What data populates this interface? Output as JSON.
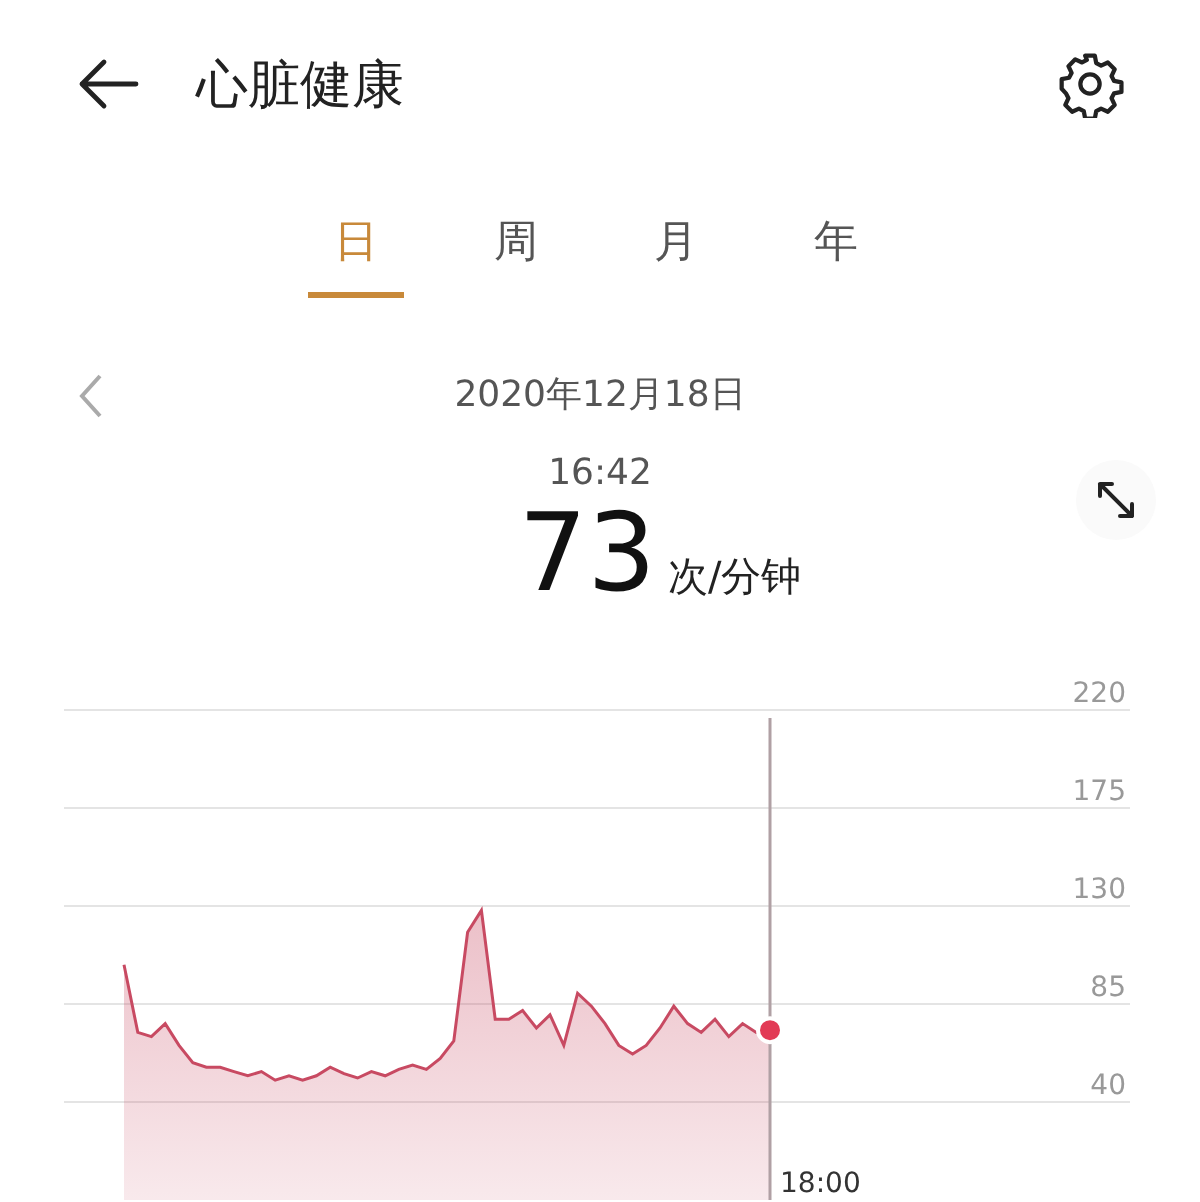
{
  "header": {
    "title": "心脏健康"
  },
  "tabs": [
    {
      "label": "日",
      "selected": true
    },
    {
      "label": "周",
      "selected": false
    },
    {
      "label": "月",
      "selected": false
    },
    {
      "label": "年",
      "selected": false
    }
  ],
  "date": "2020年12月18日",
  "reading": {
    "time": "16:42",
    "value": "73",
    "unit": "次/分钟"
  },
  "chart": {
    "chart_data": {
      "type": "area",
      "ylim": [
        40,
        220
      ],
      "yticks": [
        40,
        85,
        130,
        175,
        220
      ],
      "grid": true,
      "annotations": [
        {
          "text": "18:00"
        }
      ],
      "series": [
        {
          "color": "#c84a62",
          "values": [
            103,
            72,
            70,
            76,
            66,
            58,
            56,
            56,
            54,
            52,
            54,
            50,
            52,
            50,
            52,
            56,
            53,
            51,
            54,
            52,
            55,
            57,
            55,
            60,
            68,
            118,
            128,
            78,
            78,
            82,
            74,
            80,
            66,
            90,
            84,
            76,
            66,
            62,
            66,
            74,
            84,
            76,
            72,
            78,
            70,
            76,
            72,
            73
          ]
        }
      ]
    }
  }
}
